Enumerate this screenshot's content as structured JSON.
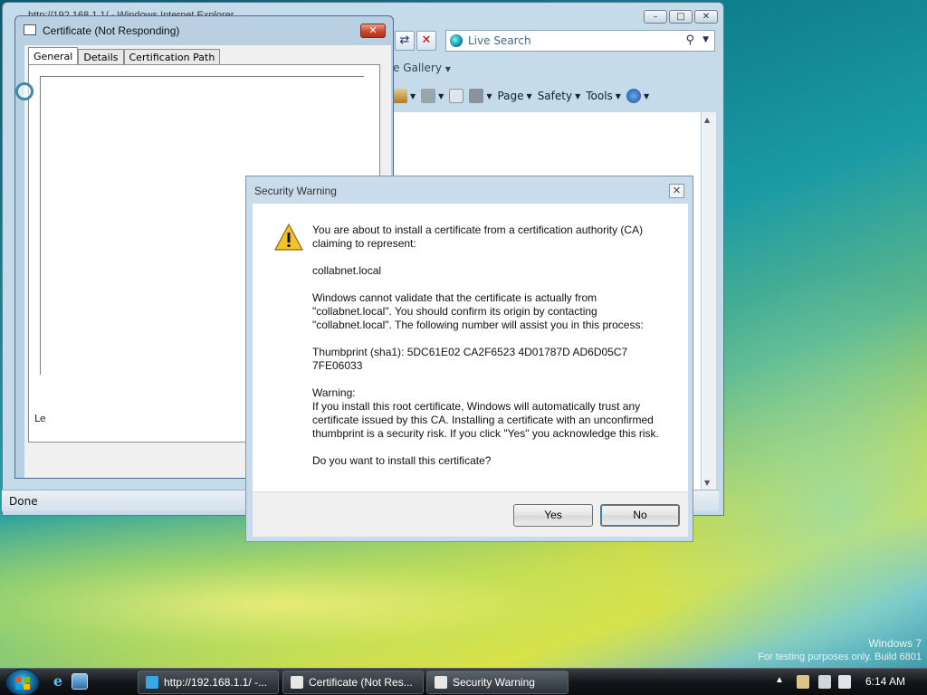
{
  "desktop": {
    "watermark_line1": "Windows 7",
    "watermark_line2": "For testing purposes only. Build 6801"
  },
  "ie_window": {
    "title": "http://192.168.1.1/ - Windows Internet Explorer",
    "search_placeholder": "Live Search",
    "fav_gallery": "e Gallery",
    "commands": {
      "page": "Page",
      "safety": "Safety",
      "tools": "Tools"
    },
    "status": "Done"
  },
  "cert_window": {
    "title": "Certificate (Not Responding)",
    "tabs": [
      {
        "label": "General"
      },
      {
        "label": "Details"
      },
      {
        "label": "Certification Path"
      }
    ],
    "learn_partial": "Le"
  },
  "security_warning": {
    "title": "Security Warning",
    "para1": "You are about to install a certificate from a certification authority (CA) claiming to represent:",
    "ca_name": "collabnet.local",
    "para2": "Windows cannot validate that the certificate is actually from \"collabnet.local\". You should confirm its origin by contacting \"collabnet.local\". The following number will assist you in this process:",
    "thumbprint": "Thumbprint (sha1): 5DC61E02 CA2F6523 4D01787D AD6D05C7 7FE06033",
    "warning_heading": "Warning:",
    "warning_body": "If you install this root certificate, Windows will automatically trust any certificate issued by this CA. Installing a certificate with an unconfirmed thumbprint is a security risk. If you click \"Yes\" you acknowledge this risk.",
    "question": "Do you want to install this certificate?",
    "yes_label": "Yes",
    "no_label": "No"
  },
  "taskbar": {
    "items": [
      {
        "label": "http://192.168.1.1/ -..."
      },
      {
        "label": "Certificate (Not Res..."
      },
      {
        "label": "Security Warning"
      }
    ],
    "time": "6:14 AM"
  },
  "colors": {
    "accent": "#3c7fb1",
    "close_red": "#c9482c"
  }
}
